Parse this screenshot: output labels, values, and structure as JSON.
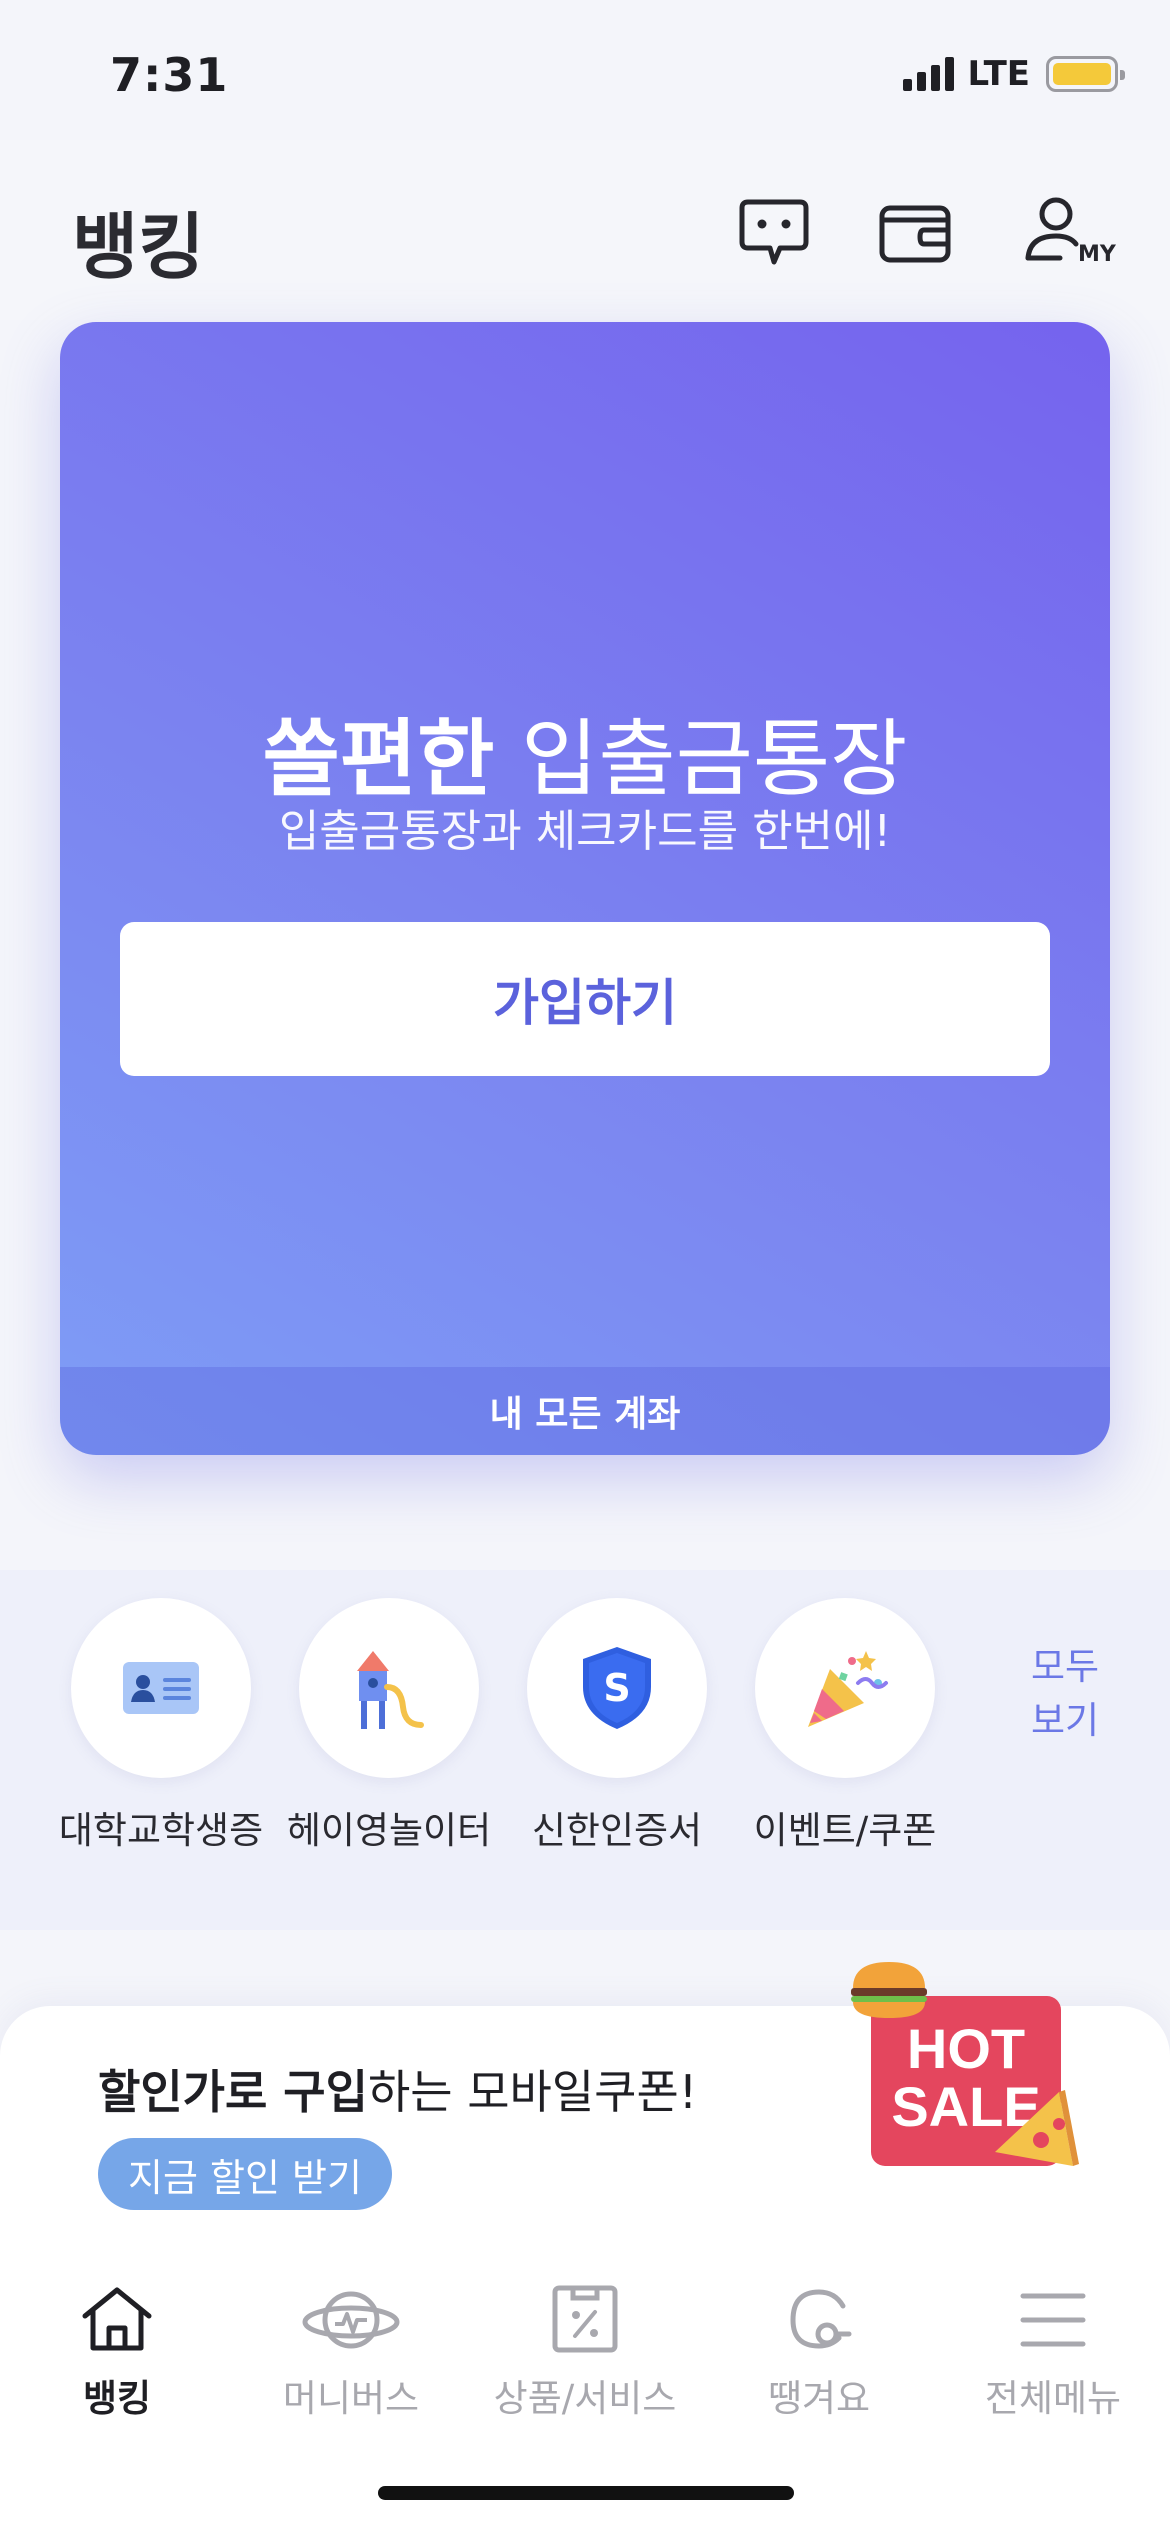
{
  "status_bar": {
    "time": "7:31",
    "network": "LTE"
  },
  "header": {
    "title": "뱅킹",
    "icons": [
      "chat-icon",
      "wallet-icon",
      "my-profile-icon"
    ],
    "my_label": "MY"
  },
  "hero": {
    "title_bold": "쏠편한",
    "title_rest": " 입출금통장",
    "subtitle": "입출금통장과 체크카드를 한번에!",
    "cta_label": "가입하기",
    "footer_label": "내 모든 계좌"
  },
  "quick_menu": {
    "items": [
      {
        "label": "대학교학생증",
        "icon": "student-id-icon"
      },
      {
        "label": "헤이영놀이터",
        "icon": "playground-icon"
      },
      {
        "label": "신한인증서",
        "icon": "shield-s-icon",
        "icon_text": "S"
      },
      {
        "label": "이벤트/쿠폰",
        "icon": "party-popper-icon"
      }
    ],
    "see_all_line1": "모두",
    "see_all_line2": "보기"
  },
  "promo": {
    "text_bold1": "할인가로 구입",
    "text_rest": "하는 모바일쿠폰!",
    "button_label": "지금 할인 받기",
    "badge_line1": "HOT",
    "badge_line2": "SALE"
  },
  "tabbar": {
    "tabs": [
      {
        "label": "뱅킹",
        "icon": "home-icon",
        "active": true
      },
      {
        "label": "머니버스",
        "icon": "planet-icon"
      },
      {
        "label": "상품/서비스",
        "icon": "product-icon"
      },
      {
        "label": "땡겨요",
        "icon": "delivery-icon"
      },
      {
        "label": "전체메뉴",
        "icon": "menu-icon"
      }
    ]
  },
  "colors": {
    "accent": "#5b62dc",
    "hero_gradient_top": "#7563ee",
    "hero_gradient_bottom": "#7e9df6",
    "promo_pill": "#76a6e8",
    "battery": "#f4c93a"
  }
}
